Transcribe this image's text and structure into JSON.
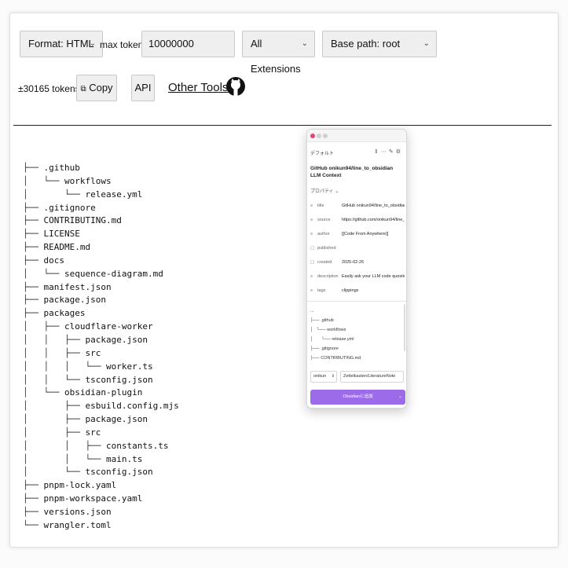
{
  "toolbar": {
    "format_select": "Format: HTML",
    "max_tokens_label": "max tokens",
    "max_tokens_value": "10000000",
    "extensions_select": "All Extensions",
    "base_path_select": "Base path: root",
    "token_count": "±30165 tokens",
    "copy_button": "Copy",
    "api_button": "API",
    "other_tools_link": "Other Tools"
  },
  "tree": [
    {
      "prefix": "├── ",
      "name": ".github"
    },
    {
      "prefix": "│   └── ",
      "name": "workflows"
    },
    {
      "prefix": "│       └── ",
      "name": "release.yml"
    },
    {
      "prefix": "├── ",
      "name": ".gitignore"
    },
    {
      "prefix": "├── ",
      "name": "CONTRIBUTING.md"
    },
    {
      "prefix": "├── ",
      "name": "LICENSE"
    },
    {
      "prefix": "├── ",
      "name": "README.md"
    },
    {
      "prefix": "├── ",
      "name": "docs"
    },
    {
      "prefix": "│   └── ",
      "name": "sequence-diagram.md"
    },
    {
      "prefix": "├── ",
      "name": "manifest.json"
    },
    {
      "prefix": "├── ",
      "name": "package.json"
    },
    {
      "prefix": "├── ",
      "name": "packages"
    },
    {
      "prefix": "│   ├── ",
      "name": "cloudflare-worker"
    },
    {
      "prefix": "│   │   ├── ",
      "name": "package.json"
    },
    {
      "prefix": "│   │   ├── ",
      "name": "src"
    },
    {
      "prefix": "│   │   │   └── ",
      "name": "worker.ts"
    },
    {
      "prefix": "│   │   └── ",
      "name": "tsconfig.json"
    },
    {
      "prefix": "│   └── ",
      "name": "obsidian-plugin"
    },
    {
      "prefix": "│       ├── ",
      "name": "esbuild.config.mjs"
    },
    {
      "prefix": "│       ├── ",
      "name": "package.json"
    },
    {
      "prefix": "│       ├── ",
      "name": "src"
    },
    {
      "prefix": "│       │   ├── ",
      "name": "constants.ts"
    },
    {
      "prefix": "│       │   └── ",
      "name": "main.ts"
    },
    {
      "prefix": "│       └── ",
      "name": "tsconfig.json"
    },
    {
      "prefix": "├── ",
      "name": "pnpm-lock.yaml"
    },
    {
      "prefix": "├── ",
      "name": "pnpm-workspace.yaml"
    },
    {
      "prefix": "├── ",
      "name": "versions.json"
    },
    {
      "prefix": "└── ",
      "name": "wrangler.toml"
    }
  ],
  "popup": {
    "template": "デフォルト",
    "title": "GitHub onikun94/line_to_obsidian LLM Context",
    "properties_toggle": "プロパティ",
    "properties": [
      {
        "icon": "≡",
        "key": "title",
        "value": "GitHub onikun94/line_to_obsidian L"
      },
      {
        "icon": "≡",
        "key": "source",
        "value": "https://github.com/onikun94/line_tc"
      },
      {
        "icon": "≡",
        "key": "author",
        "value": "[[Code From Anywhere]]"
      },
      {
        "icon": "▢",
        "key": "published",
        "value": ""
      },
      {
        "icon": "▢",
        "key": "created",
        "value": "2025-02-26"
      },
      {
        "icon": "≡",
        "key": "description",
        "value": "Easily ask your LLM code questions"
      },
      {
        "icon": "≡",
        "key": "tags",
        "value": "clippings"
      }
    ],
    "content": "...\n├── .github\n│   └── workflows\n│       └── release.yml\n├── .gitignore\n├── CONTRIBUTING.md",
    "vault": "onikun",
    "path": "Zettelkasten/LiteratureNote",
    "add_button": "Obsidianに追加"
  }
}
